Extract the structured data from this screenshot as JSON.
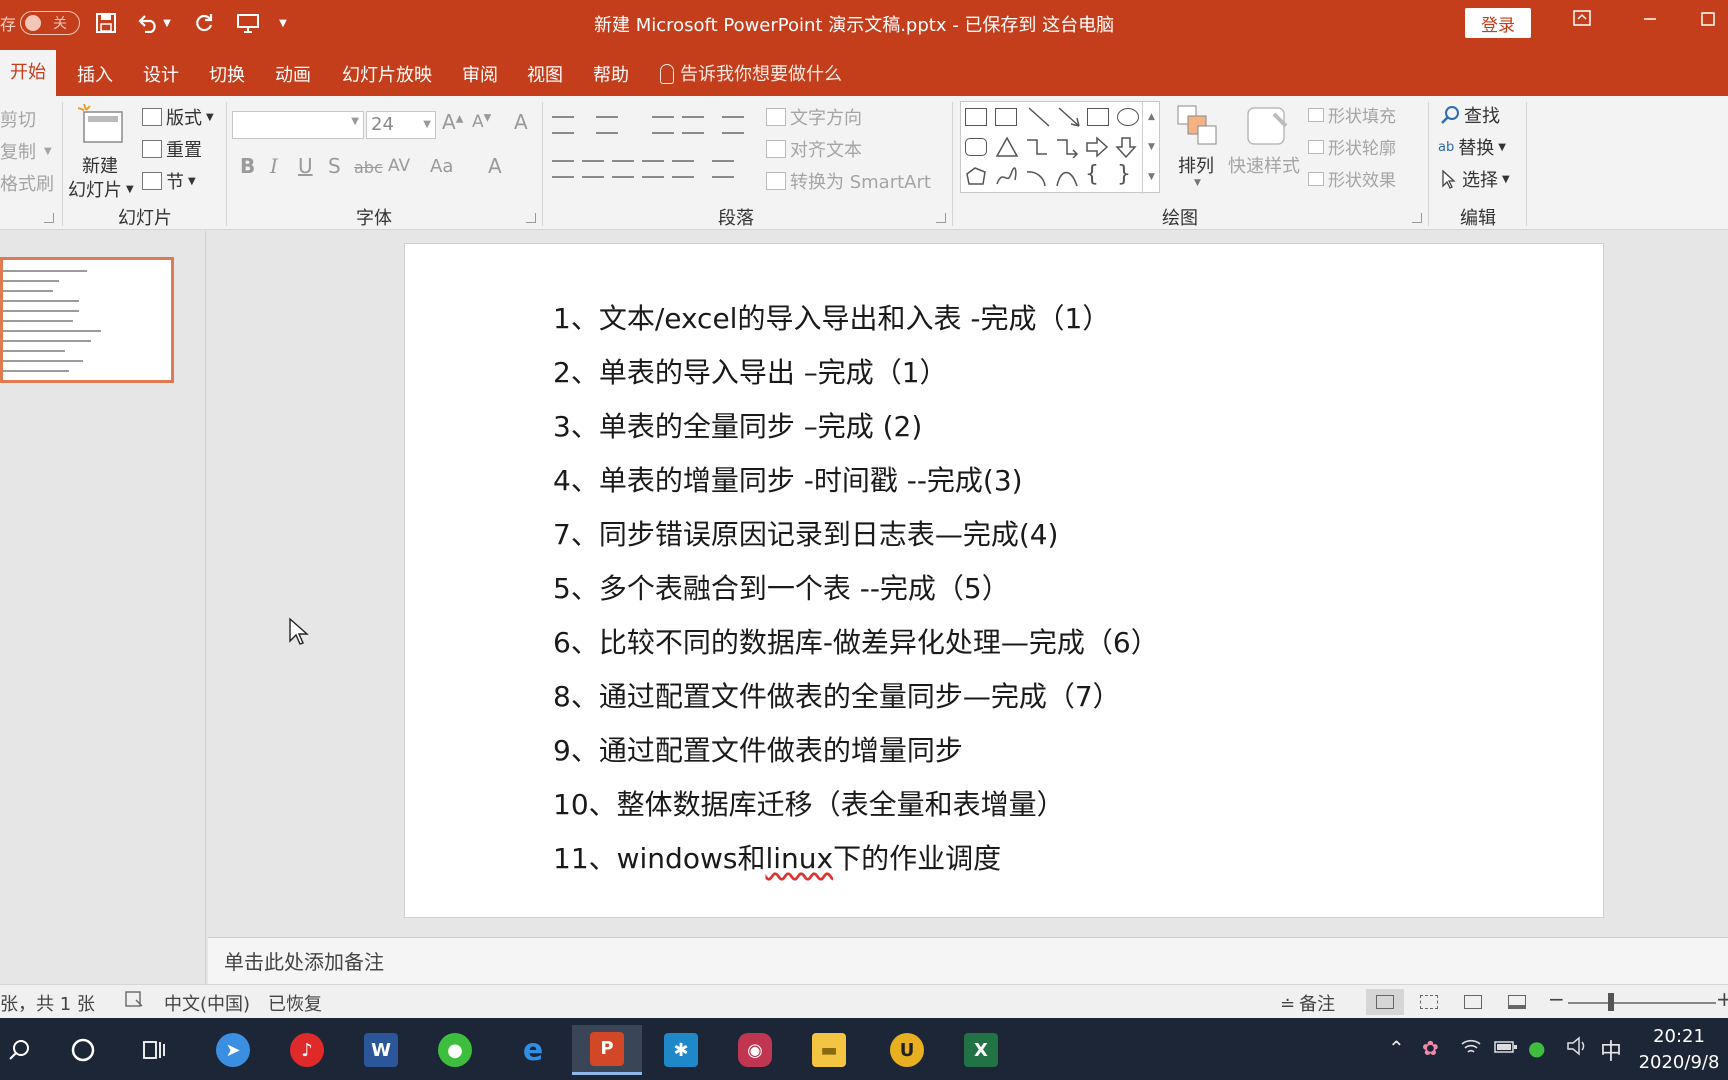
{
  "titlebar": {
    "autosave_label": "存",
    "autosave_state": "关",
    "document_title": "新建 Microsoft PowerPoint 演示文稿.pptx  -  已保存到 这台电脑",
    "login_label": "登录",
    "accent_color": "#c43e1c"
  },
  "tabs": [
    {
      "label": "开始",
      "active": true
    },
    {
      "label": "插入"
    },
    {
      "label": "设计"
    },
    {
      "label": "切换"
    },
    {
      "label": "动画"
    },
    {
      "label": "幻灯片放映"
    },
    {
      "label": "审阅"
    },
    {
      "label": "视图"
    },
    {
      "label": "帮助"
    }
  ],
  "tell_me": "告诉我你想要做什么",
  "ribbon": {
    "clipboard": {
      "cut": "剪切",
      "copy": "复制",
      "format_painter": "格式刷"
    },
    "slides": {
      "new_slide_line1": "新建",
      "new_slide_line2": "幻灯片",
      "layout": "版式",
      "reset": "重置",
      "section": "节",
      "group_label": "幻灯片"
    },
    "font": {
      "font_size": "24",
      "group_label": "字体"
    },
    "paragraph": {
      "text_direction": "文字方向",
      "align_text": "对齐文本",
      "convert_smartart": "转换为 SmartArt",
      "group_label": "段落"
    },
    "drawing": {
      "arrange": "排列",
      "quick_styles": "快速样式",
      "shape_fill": "形状填充",
      "shape_outline": "形状轮廓",
      "shape_effects": "形状效果",
      "group_label": "绘图"
    },
    "editing": {
      "find": "查找",
      "replace": "替换",
      "select": "选择",
      "group_label": "编辑"
    }
  },
  "slide": {
    "lines": [
      "1、文本/excel的导入导出和入表  -完成（1）",
      "2、单表的导入导出 –完成（1）",
      "3、单表的全量同步 –完成 (2)",
      "4、单表的增量同步  -时间戳  --完成(3)",
      "7、同步错误原因记录到日志表—完成(4)",
      "5、多个表融合到一个表  --完成（5）",
      "6、比较不同的数据库-做差异化处理—完成（6）",
      "8、通过配置文件做表的全量同步—完成（7）",
      "9、通过配置文件做表的增量同步",
      "10、整体数据库迁移（表全量和表增量）"
    ],
    "last_line_prefix": "11、windows和",
    "last_line_flagged": "linux",
    "last_line_suffix": "下的作业调度"
  },
  "notes_placeholder": "单击此处添加备注",
  "statusbar": {
    "slide_counter": "张，共 1 张",
    "language": "中文(中国)",
    "recovered": "已恢复",
    "notes_button": "备注"
  },
  "taskbar": {
    "time": "20:21",
    "date": "2020/9/8",
    "ime": "中"
  }
}
